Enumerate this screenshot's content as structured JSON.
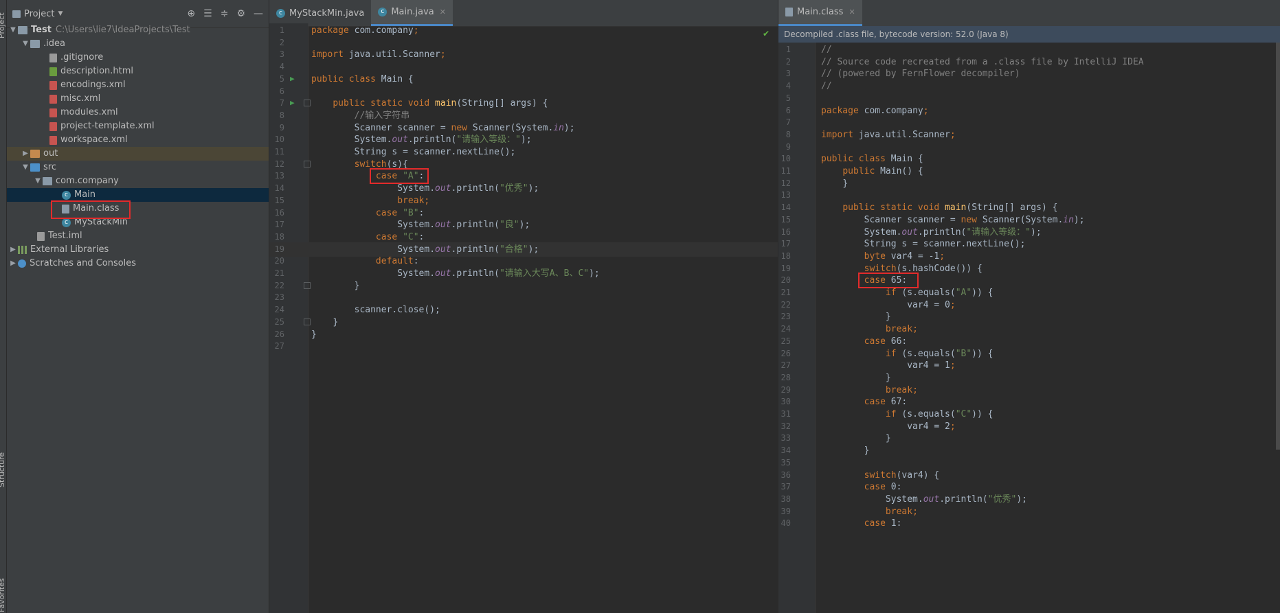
{
  "sidebar_stripe": {
    "top_label": "Project",
    "bottom_label_1": "Structure",
    "bottom_label_2": "Favorites"
  },
  "project_panel": {
    "title": "Project",
    "tree": [
      {
        "label": "Test",
        "path": "C:\\Users\\lie7\\IdeaProjects\\Test",
        "icon": "folder-icon"
      },
      {
        "label": ".idea",
        "icon": "folder-icon"
      },
      {
        "label": ".gitignore",
        "icon": "file-icon"
      },
      {
        "label": "description.html",
        "icon": "html-file-icon"
      },
      {
        "label": "encodings.xml",
        "icon": "xml-file-icon"
      },
      {
        "label": "misc.xml",
        "icon": "xml-file-icon"
      },
      {
        "label": "modules.xml",
        "icon": "xml-file-icon"
      },
      {
        "label": "project-template.xml",
        "icon": "xml-file-icon"
      },
      {
        "label": "workspace.xml",
        "icon": "xml-file-icon"
      },
      {
        "label": "out",
        "icon": "folder-icon"
      },
      {
        "label": "src",
        "icon": "folder-icon"
      },
      {
        "label": "com.company",
        "icon": "package-icon"
      },
      {
        "label": "Main",
        "icon": "class-icon"
      },
      {
        "label": "Main.class",
        "icon": "class-file-icon"
      },
      {
        "label": "MyStackMin",
        "icon": "class-icon"
      },
      {
        "label": "Test.iml",
        "icon": "iml-file-icon"
      },
      {
        "label": "External Libraries",
        "icon": "libraries-icon"
      },
      {
        "label": "Scratches and Consoles",
        "icon": "scratches-icon"
      }
    ]
  },
  "left_tabs": [
    {
      "label": "MyStackMin.java"
    },
    {
      "label": "Main.java"
    }
  ],
  "right_tabs": [
    {
      "label": "Main.class"
    }
  ],
  "left_editor": {
    "lines": [
      {
        "n": "1",
        "c": "package com.company;"
      },
      {
        "n": "2",
        "c": ""
      },
      {
        "n": "3",
        "c": "import java.util.Scanner;"
      },
      {
        "n": "4",
        "c": ""
      },
      {
        "n": "5",
        "c": "public class Main {"
      },
      {
        "n": "6",
        "c": ""
      },
      {
        "n": "7",
        "c": "    public static void main(String[] args) {"
      },
      {
        "n": "8",
        "c": "        //输入字符串"
      },
      {
        "n": "9",
        "c": "        Scanner scanner = new Scanner(System.in);"
      },
      {
        "n": "10",
        "c": "        System.out.println(\"请输入等级：\");"
      },
      {
        "n": "11",
        "c": "        String s = scanner.nextLine();"
      },
      {
        "n": "12",
        "c": "        switch(s){"
      },
      {
        "n": "13",
        "c": "            case \"A\":"
      },
      {
        "n": "14",
        "c": "                System.out.println(\"优秀\");"
      },
      {
        "n": "15",
        "c": "                break;"
      },
      {
        "n": "16",
        "c": "            case \"B\":"
      },
      {
        "n": "17",
        "c": "                System.out.println(\"良\");"
      },
      {
        "n": "18",
        "c": "            case \"C\":"
      },
      {
        "n": "19",
        "c": "                System.out.println(\"合格\");"
      },
      {
        "n": "20",
        "c": "            default:"
      },
      {
        "n": "21",
        "c": "                System.out.println(\"请输入大写A、B、C\");"
      },
      {
        "n": "22",
        "c": "        }"
      },
      {
        "n": "23",
        "c": ""
      },
      {
        "n": "24",
        "c": "        scanner.close();"
      },
      {
        "n": "25",
        "c": "    }"
      },
      {
        "n": "26",
        "c": "}"
      },
      {
        "n": "27",
        "c": ""
      }
    ]
  },
  "decompiled_banner": "Decompiled .class file, bytecode version: 52.0 (Java 8)",
  "right_editor": {
    "lines": [
      {
        "n": "1",
        "c": "//"
      },
      {
        "n": "2",
        "c": "// Source code recreated from a .class file by IntelliJ IDEA"
      },
      {
        "n": "3",
        "c": "// (powered by FernFlower decompiler)"
      },
      {
        "n": "4",
        "c": "//"
      },
      {
        "n": "5",
        "c": ""
      },
      {
        "n": "6",
        "c": "package com.company;"
      },
      {
        "n": "7",
        "c": ""
      },
      {
        "n": "8",
        "c": "import java.util.Scanner;"
      },
      {
        "n": "9",
        "c": ""
      },
      {
        "n": "10",
        "c": "public class Main {"
      },
      {
        "n": "11",
        "c": "    public Main() {"
      },
      {
        "n": "12",
        "c": "    }"
      },
      {
        "n": "13",
        "c": ""
      },
      {
        "n": "14",
        "c": "    public static void main(String[] args) {"
      },
      {
        "n": "15",
        "c": "        Scanner scanner = new Scanner(System.in);"
      },
      {
        "n": "16",
        "c": "        System.out.println(\"请输入等级：\");"
      },
      {
        "n": "17",
        "c": "        String s = scanner.nextLine();"
      },
      {
        "n": "18",
        "c": "        byte var4 = -1;"
      },
      {
        "n": "19",
        "c": "        switch(s.hashCode()) {"
      },
      {
        "n": "20",
        "c": "        case 65:"
      },
      {
        "n": "21",
        "c": "            if (s.equals(\"A\")) {"
      },
      {
        "n": "22",
        "c": "                var4 = 0;"
      },
      {
        "n": "23",
        "c": "            }"
      },
      {
        "n": "24",
        "c": "            break;"
      },
      {
        "n": "25",
        "c": "        case 66:"
      },
      {
        "n": "26",
        "c": "            if (s.equals(\"B\")) {"
      },
      {
        "n": "27",
        "c": "                var4 = 1;"
      },
      {
        "n": "28",
        "c": "            }"
      },
      {
        "n": "29",
        "c": "            break;"
      },
      {
        "n": "30",
        "c": "        case 67:"
      },
      {
        "n": "31",
        "c": "            if (s.equals(\"C\")) {"
      },
      {
        "n": "32",
        "c": "                var4 = 2;"
      },
      {
        "n": "33",
        "c": "            }"
      },
      {
        "n": "34",
        "c": "        }"
      },
      {
        "n": "35",
        "c": ""
      },
      {
        "n": "36",
        "c": "        switch(var4) {"
      },
      {
        "n": "37",
        "c": "        case 0:"
      },
      {
        "n": "38",
        "c": "            System.out.println(\"优秀\");"
      },
      {
        "n": "39",
        "c": "            break;"
      },
      {
        "n": "40",
        "c": "        case 1:"
      }
    ]
  },
  "colors": {
    "keyword": "#cc7832",
    "string": "#6a8759",
    "comment": "#808080",
    "static_field": "#9876aa",
    "highlight_box": "#e32b2b",
    "selection": "#0d293e"
  }
}
